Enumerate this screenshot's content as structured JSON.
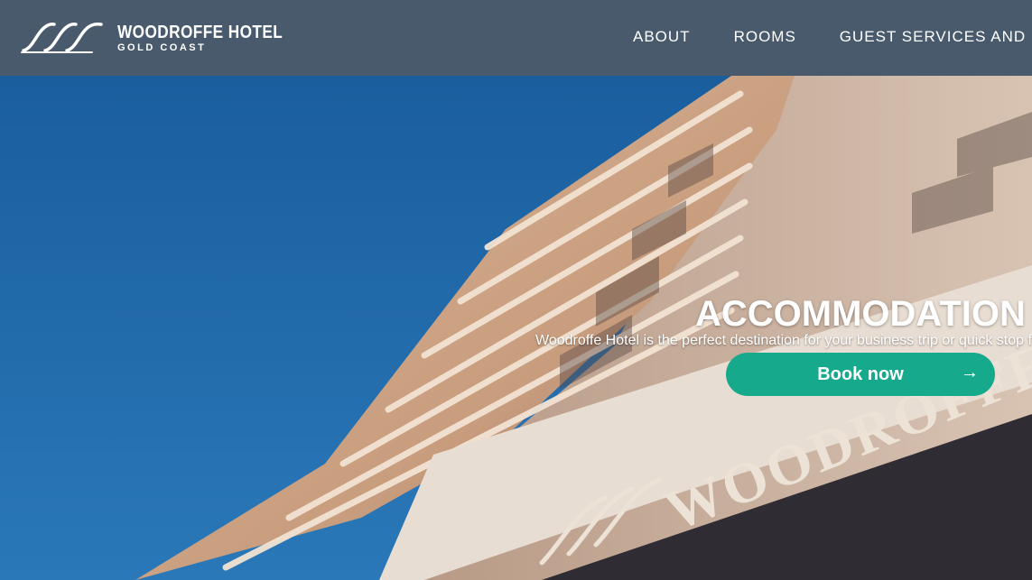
{
  "brand": {
    "name": "WOODROFFE HOTEL",
    "location": "GOLD COAST",
    "logo_icon": "wave-logo-icon"
  },
  "nav": {
    "items": [
      {
        "label": "ABOUT"
      },
      {
        "label": "ROOMS"
      },
      {
        "label": "GUEST SERVICES AND I"
      }
    ]
  },
  "hero": {
    "title": "ACCOMMODATION",
    "subtitle": "Woodroffe Hotel is the perfect destination for your business trip or quick stop f",
    "cta_label": "Book now",
    "cta_icon": "arrow-right-icon",
    "building_sign": "WOODROFFE"
  },
  "colors": {
    "header": "#485a6c",
    "sky": "#1f6aa8",
    "cta": "#16a98c"
  }
}
